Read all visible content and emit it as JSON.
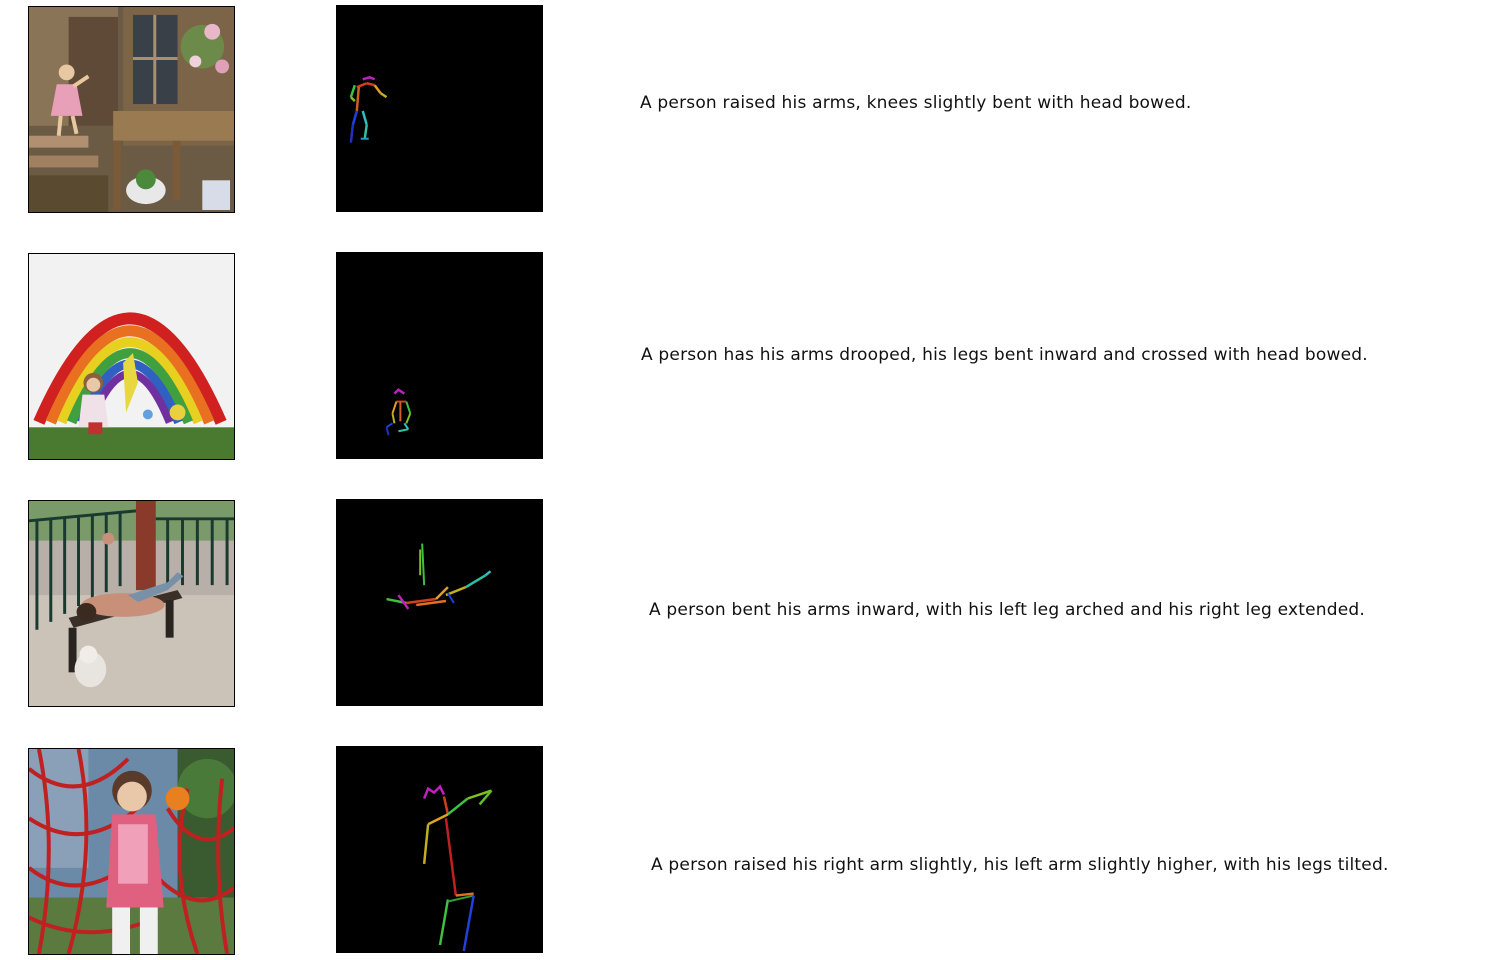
{
  "rows": [
    {
      "photo": "child-climbing-porch",
      "caption": "A person raised his arms, knees slightly bent with head bowed."
    },
    {
      "photo": "child-before-rainbow-painting",
      "caption": "A person has his arms drooped, his legs bent inward and crossed with head bowed."
    },
    {
      "photo": "man-lying-on-bench",
      "caption": "A person bent his arms inward, with his left leg arched and his right leg extended."
    },
    {
      "photo": "child-on-rope-net",
      "caption": "A person raised his right arm slightly, his left arm slightly higher, with his legs tilted."
    }
  ],
  "skeleton_colors": {
    "head": "#c020c0",
    "torso": "#d04020",
    "arm_right": "#e0a020",
    "arm_left": "#40c040",
    "leg_right": "#2040e0",
    "leg_left": "#30c0c0"
  }
}
